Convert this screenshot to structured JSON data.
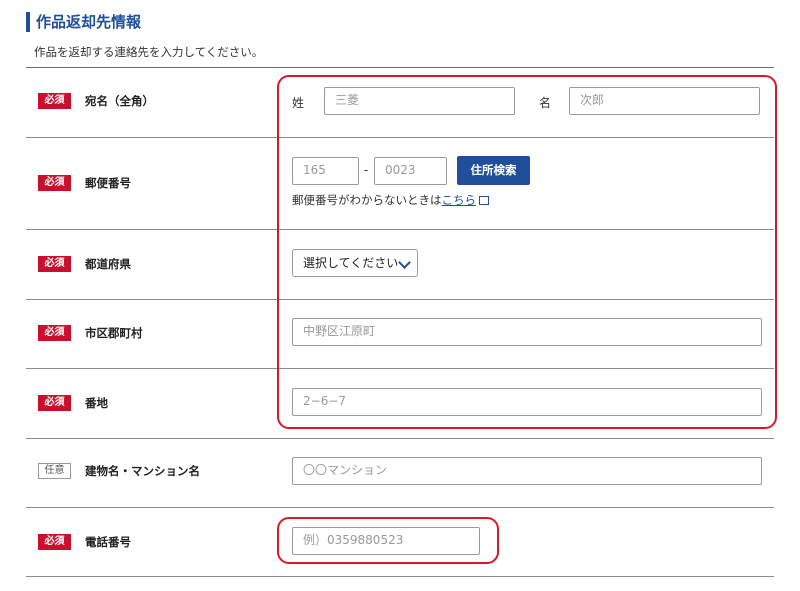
{
  "section": {
    "title": "作品返却先情報",
    "description": "作品を返却する連絡先を入力してください。"
  },
  "badges": {
    "required": "必須",
    "optional": "任意"
  },
  "fields": {
    "name": {
      "label": "宛名（全角）",
      "sei_label": "姓",
      "sei_placeholder": "三菱",
      "mei_label": "名",
      "mei_placeholder": "次郎"
    },
    "postal": {
      "label": "郵便番号",
      "first_placeholder": "165",
      "separator": "-",
      "second_placeholder": "0023",
      "search_button": "住所検索",
      "hint_text": "郵便番号がわからないときは",
      "hint_link": "こちら"
    },
    "prefecture": {
      "label": "都道府県",
      "selected": "選択してください"
    },
    "city": {
      "label": "市区郡町村",
      "placeholder": "中野区江原町"
    },
    "street": {
      "label": "番地",
      "placeholder": "2−6−7"
    },
    "building": {
      "label": "建物名・マンション名",
      "placeholder": "〇〇マンション"
    },
    "phone": {
      "label": "電話番号",
      "placeholder": "例）0359880523"
    }
  },
  "colors": {
    "accent": "#1e4f98",
    "required": "#c8102e",
    "highlight": "#d61a2a"
  }
}
